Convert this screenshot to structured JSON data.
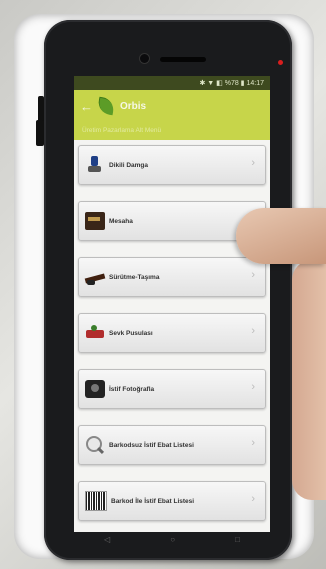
{
  "statusbar": {
    "text": "✱ ▼ ◧ %78 ▮ 14:17"
  },
  "appbar": {
    "back_label": "←",
    "title": "Orbis"
  },
  "subtitle": "Üretim Pazarlama Alt Menü",
  "menu": [
    {
      "label": "Dikili Damga",
      "icon": "stamp-icon"
    },
    {
      "label": "Mesaha",
      "icon": "measuring-tool-icon"
    },
    {
      "label": "Sürütme-Taşıma",
      "icon": "log-truck-icon"
    },
    {
      "label": "Sevk Pusulası",
      "icon": "truck-icon"
    },
    {
      "label": "İstif Fotoğrafla",
      "icon": "camera-icon"
    },
    {
      "label": "Barkodsuz İstif Ebat Listesi",
      "icon": "magnifier-icon"
    },
    {
      "label": "Barkod İle İstif Ebat Listesi",
      "icon": "barcode-icon"
    }
  ],
  "chevron": "›",
  "navbar": {
    "back": "◁",
    "home": "○",
    "recents": "□"
  },
  "colors": {
    "appbar": "#c7d54a",
    "statusbar": "#3e4a1f",
    "leaf": "#5c9c27"
  }
}
